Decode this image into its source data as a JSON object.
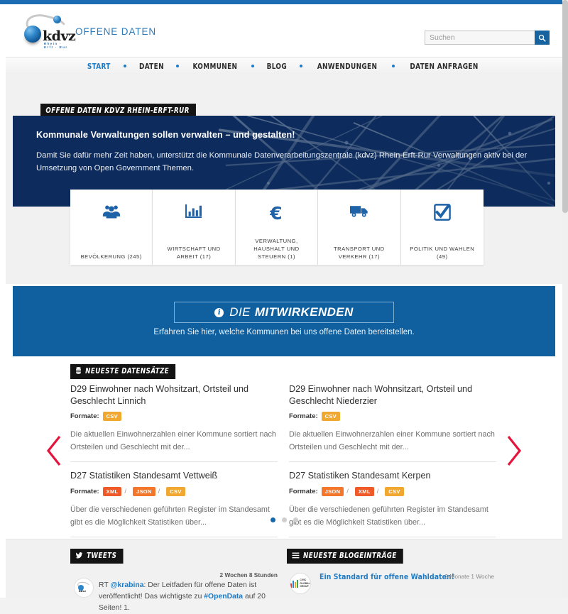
{
  "header": {
    "brand_name": "kdvz",
    "brand_sub": "Rhein · Erft · Rur",
    "site_title": "OFFENE DATEN"
  },
  "search": {
    "placeholder": "Suchen",
    "value": "",
    "icon": "search-icon"
  },
  "nav": {
    "items": [
      {
        "label": "START",
        "active": true
      },
      {
        "label": "DATEN",
        "active": false
      },
      {
        "label": "KOMMUNEN",
        "active": false
      },
      {
        "label": "BLOG",
        "active": false
      },
      {
        "label": "ANWENDUNGEN",
        "active": false
      },
      {
        "label": "DATEN ANFRAGEN",
        "active": false
      }
    ]
  },
  "hero": {
    "tag": "OFFENE DATEN KDVZ RHEIN-ERFT-RUR",
    "headline": "Kommunale Verwaltungen sollen verwalten – und gestalten!",
    "body": "Damit Sie dafür mehr Zeit haben, unterstützt die Kommunale Datenverarbeitungszentrale (kdvz) Rhein-Erft-Rur Verwaltungen aktiv bei der Umsetzung von Open Government Themen."
  },
  "categories": [
    {
      "icon": "people-group-icon",
      "label": "BEVÖLKERUNG (245)"
    },
    {
      "icon": "bar-chart-icon",
      "label": "WIRTSCHAFT UND ARBEIT (17)"
    },
    {
      "icon": "euro-icon",
      "label": "VERWALTUNG, HAUSHALT UND STEUERN (1)"
    },
    {
      "icon": "truck-icon",
      "label": "TRANSPORT UND VERKEHR (17)"
    },
    {
      "icon": "checkbox-icon",
      "label": "POLITIK UND WAHLEN (49)"
    }
  ],
  "contributors": {
    "button_word1": "DIE",
    "button_word2": "MITWIRKENDEN",
    "button_icon": "info-icon",
    "subtitle": "Erfahren Sie hier, welche Kommunen bei uns offene Daten bereitstellen."
  },
  "datasets": {
    "tag": "NEUESTE DATENSÄTZE",
    "tag_icon": "database-icon",
    "formats_label": "Formate:",
    "left": [
      {
        "title": "D29 Einwohner nach Wohsitzart, Ortsteil und Geschlecht Linnich",
        "formats": [
          {
            "name": "CSV",
            "color": "#f0a830"
          }
        ],
        "description": "Die aktuellen Einwohnerzahlen einer Kommune sortiert nach Ortsteilen und Geschlecht mit der..."
      },
      {
        "title": "D27 Statistiken Standesamt Vettweiß",
        "formats": [
          {
            "name": "XML",
            "color": "#f05a28"
          },
          {
            "name": "JSON",
            "color": "#f4762a"
          },
          {
            "name": "CSV",
            "color": "#f0a830"
          }
        ],
        "description": "Über die verschiedenen geführten Register im Standesamt gibt es die Möglichkeit Statistiken über..."
      }
    ],
    "right": [
      {
        "title": "D29 Einwohner nach Wohnsitzart, Ortsteil und Geschlecht Niederzier",
        "formats": [
          {
            "name": "CSV",
            "color": "#f0a830"
          }
        ],
        "description": "Die aktuellen Einwohnerzahlen einer Kommune sortiert nach Ortsteilen und Geschlecht mit der..."
      },
      {
        "title": "D27 Statistiken Standesamt Kerpen",
        "formats": [
          {
            "name": "JSON",
            "color": "#f4762a"
          },
          {
            "name": "XML",
            "color": "#f05a28"
          },
          {
            "name": "CSV",
            "color": "#f0a830"
          }
        ],
        "description": "Über die verschiedenen geführten Register im Standesamt gibt es die Möglichkeit Statistiken über..."
      }
    ],
    "pagination": {
      "total": 3,
      "active": 1
    },
    "prev_icon": "chevron-left-icon",
    "next_icon": "chevron-right-icon",
    "arrow_color": "#e5143c"
  },
  "tweets": {
    "tag": "TWEETS",
    "tag_icon": "twitter-bird-icon",
    "item": {
      "time": "2 Wochen 8 Stunden",
      "prefix": "RT ",
      "handle": "@krabina",
      "text_1": ": Der Leitfaden für offene Daten ist veröffentlicht! Das wichtigste zu ",
      "hashtag": "#OpenData",
      "text_2": " auf 20 Seiten! 1."
    }
  },
  "blog": {
    "tag": "NEUESTE BLOGEINTRÄGE",
    "tag_icon": "list-icon",
    "item": {
      "title": "Ein Standard für offene Wahldaten!",
      "time": "3 Monate 1 Woche"
    }
  },
  "colors": {
    "accent_blue": "#1f7ac4",
    "band_blue": "#10609f",
    "hero_navy": "#0d2b5c",
    "tag_black": "#141414"
  }
}
